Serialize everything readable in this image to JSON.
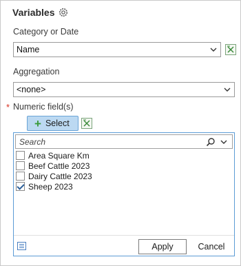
{
  "header": {
    "title": "Variables",
    "icon": "gear-icon"
  },
  "category": {
    "label": "Category or Date",
    "value": "Name",
    "icon": "chevron-down-icon"
  },
  "aggregation": {
    "label": "Aggregation",
    "value": "<none>",
    "icon": "chevron-down-icon"
  },
  "numeric": {
    "label": "Numeric field(s)",
    "required_marker": "*",
    "select_label": "Select"
  },
  "field_picker": {
    "search_placeholder": "Search",
    "items": [
      {
        "label": "Area Square Km",
        "checked": false
      },
      {
        "label": "Beef Cattle 2023",
        "checked": false
      },
      {
        "label": "Dairy Cattle 2023",
        "checked": false
      },
      {
        "label": "Sheep 2023",
        "checked": true
      }
    ],
    "apply_label": "Apply",
    "cancel_label": "Cancel"
  },
  "colors": {
    "accent": "#5b9bd5",
    "select_bg": "#bcd9f2",
    "required": "#d83020",
    "expression_green": "#3a8a3a"
  }
}
